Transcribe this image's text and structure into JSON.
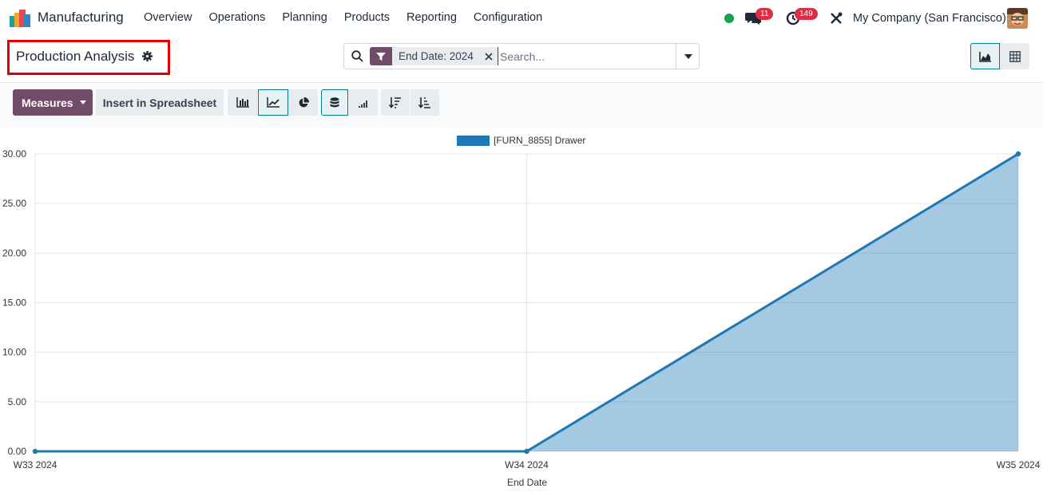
{
  "navbar": {
    "app_name": "Manufacturing",
    "menu": [
      "Overview",
      "Operations",
      "Planning",
      "Products",
      "Reporting",
      "Configuration"
    ],
    "chat_badge": "11",
    "activity_badge": "149",
    "company": "My Company (San Francisco)"
  },
  "control_panel": {
    "title": "Production Analysis",
    "facet_value": "End Date: 2024",
    "search_placeholder": "Search..."
  },
  "toolbar": {
    "measures_label": "Measures",
    "spreadsheet_label": "Insert in Spreadsheet"
  },
  "colors": {
    "brand": "#714b67",
    "accent": "#017e84",
    "series": "#1f77b4",
    "highlight_box": "#e00000"
  },
  "chart_data": {
    "type": "area",
    "categories": [
      "W33 2024",
      "W34 2024",
      "W35 2024"
    ],
    "series": [
      {
        "name": "[FURN_8855] Drawer",
        "values": [
          0,
          0,
          30
        ]
      }
    ],
    "xlabel": "End Date",
    "ylabel": "",
    "ylim": [
      0,
      30
    ],
    "yticks": [
      "0.00",
      "5.00",
      "10.00",
      "15.00",
      "20.00",
      "25.00",
      "30.00"
    ],
    "grid": true,
    "legend": "top-center"
  }
}
